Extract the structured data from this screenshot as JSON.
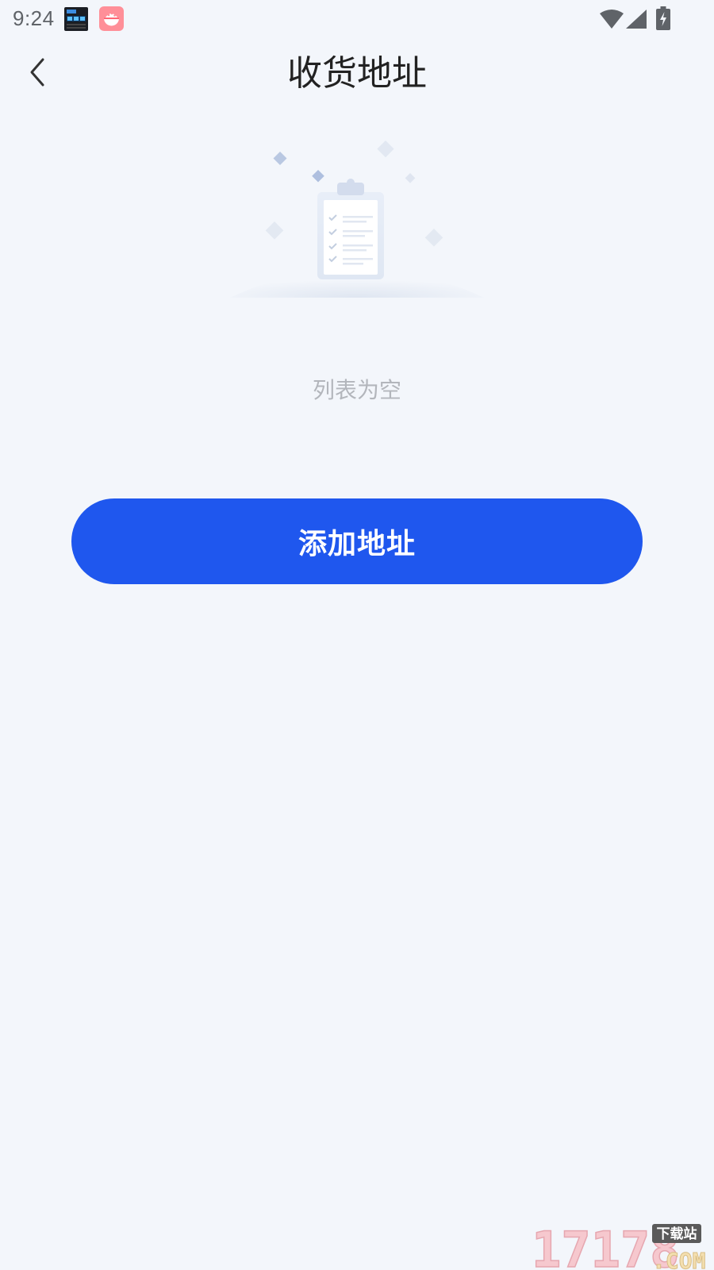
{
  "status_bar": {
    "time": "9:24",
    "notification_icons": [
      "clock-widget-app-icon",
      "rice-bowl-app-icon"
    ],
    "system_icons": [
      "wifi-icon",
      "cellular-signal-icon",
      "battery-charging-icon"
    ]
  },
  "header": {
    "title": "收货地址",
    "back_icon": "chevron-left-icon"
  },
  "empty_state": {
    "illustration": "clipboard-checklist-illustration",
    "message": "列表为空"
  },
  "actions": {
    "add_address_label": "添加地址"
  },
  "watermark": {
    "number_text": "17178",
    "domain_suffix": ".COM",
    "tag_text": "下载站"
  },
  "colors": {
    "background": "#f3f6fb",
    "primary_button": "#1f57ee",
    "title_text": "#222222",
    "empty_text": "#b3b6bc"
  }
}
